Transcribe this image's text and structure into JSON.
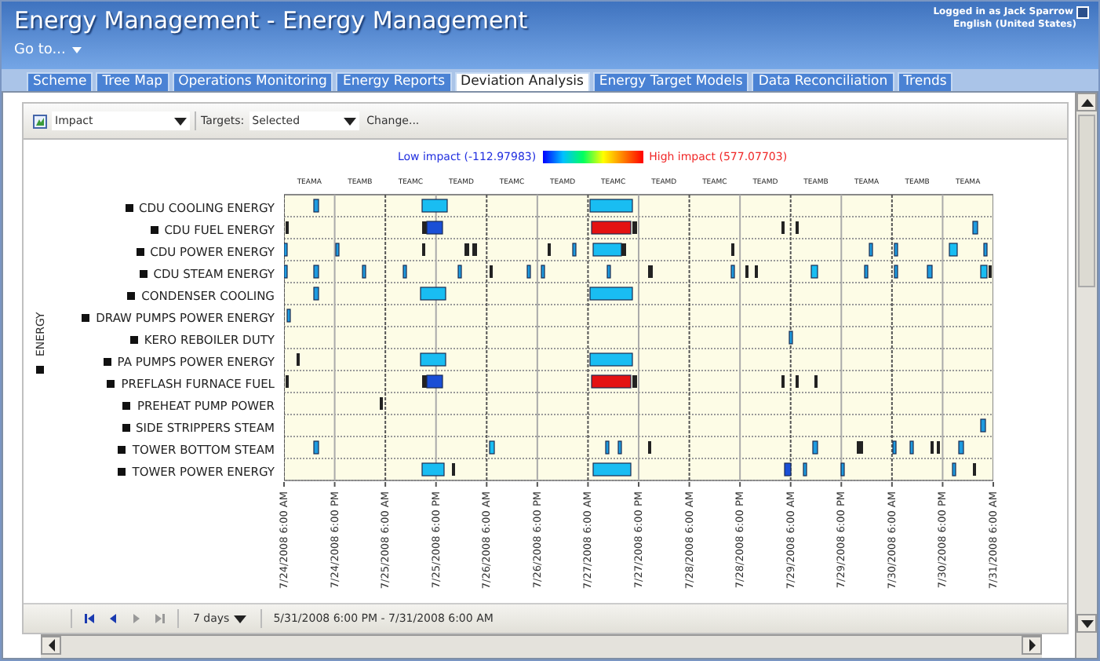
{
  "window": {
    "title": "Energy Management - Energy Management",
    "user": "Logged in as Jack Sparrow",
    "locale": "English (United States)"
  },
  "goto": "Go to...",
  "tabs": [
    {
      "label": "Scheme",
      "selected": false
    },
    {
      "label": "Tree Map",
      "selected": false
    },
    {
      "label": "Operations Monitoring",
      "selected": false
    },
    {
      "label": "Energy Reports",
      "selected": false
    },
    {
      "label": "Deviation Analysis",
      "selected": true
    },
    {
      "label": "Energy Target Models",
      "selected": false
    },
    {
      "label": "Data Reconciliation",
      "selected": false
    },
    {
      "label": "Trends",
      "selected": false
    }
  ],
  "toolbar": {
    "measure": "Impact",
    "targets_label": "Targets:",
    "targets": "Selected",
    "change": "Change..."
  },
  "legend": {
    "low": "Low impact (-112.97983)",
    "high": "High impact (577.07703)"
  },
  "chart": {
    "ylabel": "ENERGY",
    "teams": [
      "TEAMA",
      "TEAMB",
      "TEAMC",
      "TEAMD",
      "TEAMC",
      "TEAMD",
      "TEAMC",
      "TEAMD",
      "TEAMC",
      "TEAMD",
      "TEAMB",
      "TEAMA",
      "TEAMB",
      "TEAMA"
    ],
    "rows": [
      "CDU COOLING ENERGY",
      "CDU FUEL ENERGY",
      "CDU POWER ENERGY",
      "CDU STEAM ENERGY",
      "CONDENSER COOLING",
      "DRAW PUMPS POWER ENERGY",
      "KERO REBOILER DUTY",
      "PA PUMPS POWER ENERGY",
      "PREFLASH FURNACE FUEL",
      "PREHEAT PUMP POWER",
      "SIDE STRIPPERS STEAM",
      "TOWER BOTTOM STEAM",
      "TOWER POWER ENERGY"
    ],
    "ticks": [
      "7/24/2008 6:00 AM",
      "7/24/2008 6:00 PM",
      "7/25/2008 6:00 AM",
      "7/25/2008 6:00 PM",
      "7/26/2008 6:00 AM",
      "7/26/2008 6:00 PM",
      "7/27/2008 6:00 AM",
      "7/27/2008 6:00 PM",
      "7/28/2008 6:00 AM",
      "7/28/2008 6:00 PM",
      "7/29/2008 6:00 AM",
      "7/29/2008 6:00 PM",
      "7/30/2008 6:00 AM",
      "7/30/2008 6:00 PM",
      "7/31/2008 6:00 AM"
    ]
  },
  "pager": {
    "period": "7 days",
    "range": "5/31/2008 6:00 PM - 7/31/2008 6:00 AM"
  }
}
